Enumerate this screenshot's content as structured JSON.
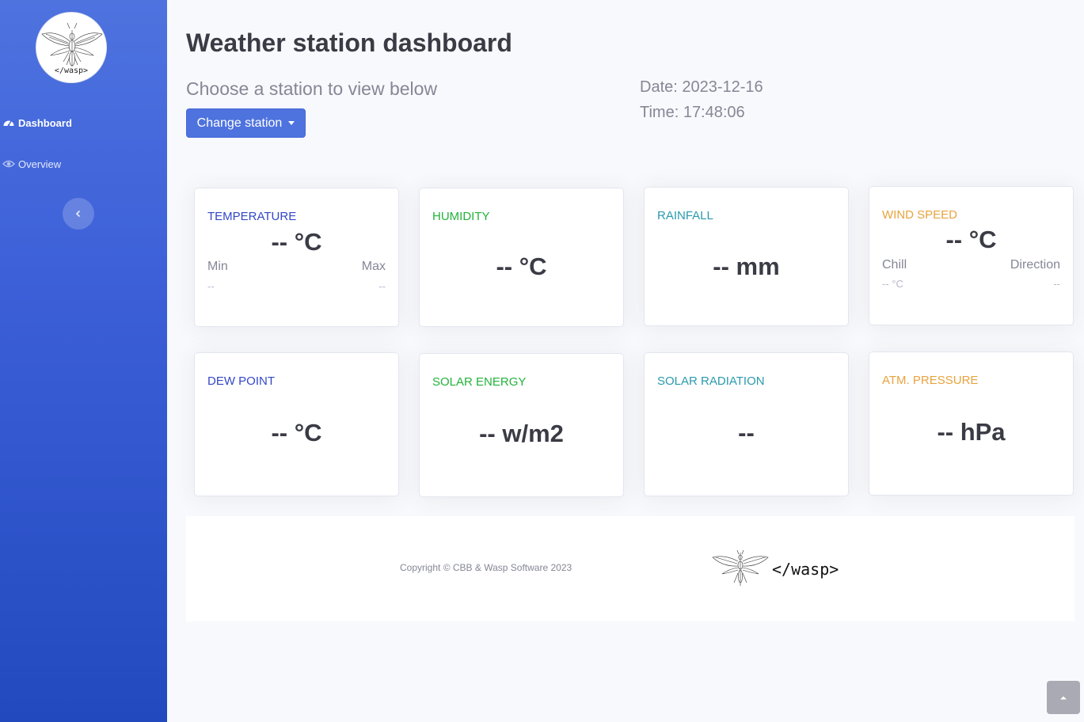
{
  "sidebar": {
    "logo_text": "</wasp>",
    "items": [
      {
        "label": "Dashboard",
        "icon": "tachometer-icon",
        "active": true
      },
      {
        "label": "Overview",
        "icon": "eye-icon",
        "active": false
      }
    ],
    "toggle_icon": "chevron-left-icon"
  },
  "header": {
    "title": "Weather station dashboard",
    "subtitle": "Choose a station to view below",
    "change_station_label": "Change station",
    "date": "Date: 2023-12-16",
    "time": "Time: 17:48:06"
  },
  "cards": {
    "temperature": {
      "label": "TEMPERATURE",
      "value": "-- °C",
      "min_label": "Min",
      "max_label": "Max",
      "min_value": "--",
      "max_value": "--"
    },
    "humidity": {
      "label": "HUMIDITY",
      "value": "-- °C"
    },
    "rainfall": {
      "label": "RAINFALL",
      "value": "-- mm"
    },
    "wind_speed": {
      "label": "WIND SPEED",
      "value": "-- °C",
      "chill_label": "Chill",
      "direction_label": "Direction",
      "chill_value": "-- °C",
      "direction_value": "--"
    },
    "dew_point": {
      "label": "DEW POINT",
      "value": "-- °C"
    },
    "solar_energy": {
      "label": "SOLAR ENERGY",
      "value": "-- w/m2"
    },
    "solar_radiation": {
      "label": "SOLAR RADIATION",
      "value": "--"
    },
    "atm_pressure": {
      "label": "ATM. PRESSURE",
      "value": "-- hPa"
    }
  },
  "footer": {
    "copyright": "Copyright © CBB & Wasp Software 2023",
    "logo_text": "</wasp>"
  },
  "colors": {
    "sidebar_top": "#4e73df",
    "sidebar_bottom": "#224abe",
    "primary": "#3347c8",
    "success": "#22b33a",
    "info": "#2a9aad",
    "warning": "#e8a33d"
  }
}
